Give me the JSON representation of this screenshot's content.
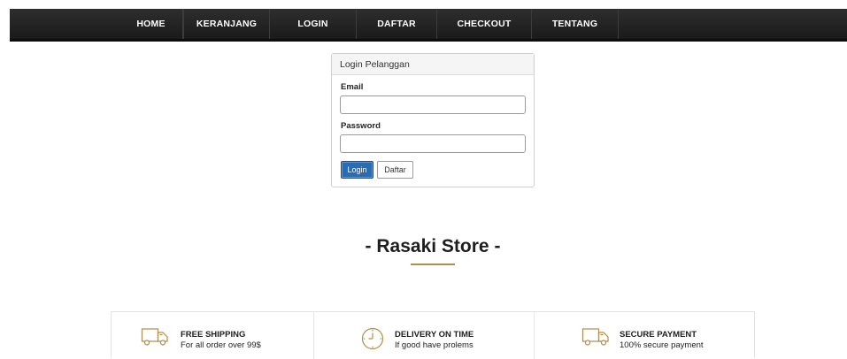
{
  "nav": {
    "items": [
      {
        "label": "HOME"
      },
      {
        "label": "KERANJANG"
      },
      {
        "label": "LOGIN"
      },
      {
        "label": "DAFTAR"
      },
      {
        "label": "CHECKOUT"
      },
      {
        "label": "TENTANG"
      }
    ]
  },
  "login": {
    "heading": "Login Pelanggan",
    "email_label": "Email",
    "email_value": "",
    "password_label": "Password",
    "password_value": "",
    "login_button": "Login",
    "register_button": "Daftar"
  },
  "store": {
    "title": "- Rasaki Store -"
  },
  "features": [
    {
      "icon": "truck-icon",
      "title": "FREE SHIPPING",
      "desc": "For all order over 99$"
    },
    {
      "icon": "clock-icon",
      "title": "DELIVERY ON TIME",
      "desc": "If good have prolems"
    },
    {
      "icon": "truck-icon",
      "title": "SECURE PAYMENT",
      "desc": "100% secure payment"
    }
  ],
  "colors": {
    "nav_bg": "#1f1f1f",
    "accent_gold": "#b08d4a",
    "primary_button": "#2b6cb0"
  }
}
